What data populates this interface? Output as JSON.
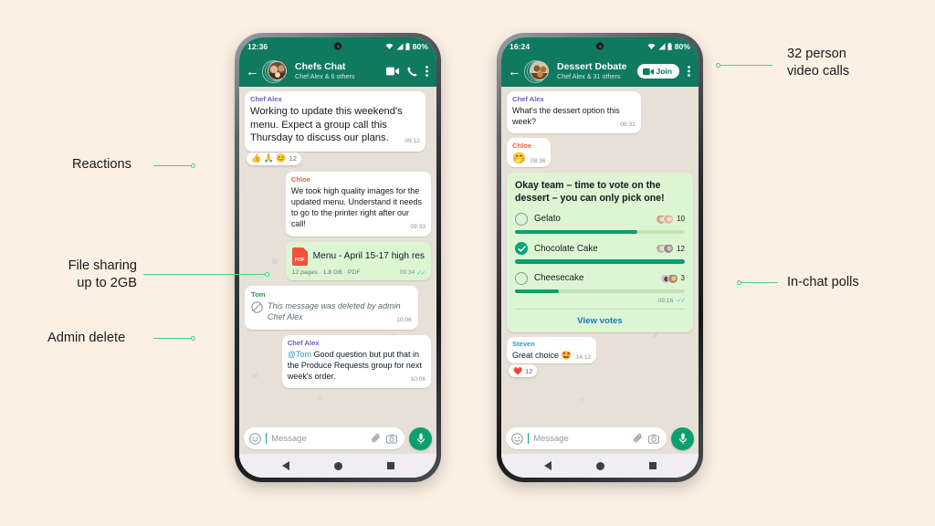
{
  "background_color": "#fcf0e4",
  "brand": {
    "green": "#0f7a60",
    "accent_green": "#0aa06e",
    "link_blue": "#1478c4",
    "lead_green": "#4bd07f"
  },
  "annotations": [
    {
      "id": "video-calls",
      "text": "32 person\nvideo calls"
    },
    {
      "id": "in-chat-polls",
      "text": "In-chat polls"
    },
    {
      "id": "reactions",
      "text": "Reactions"
    },
    {
      "id": "file-sharing",
      "text": "File sharing\nup to 2GB"
    },
    {
      "id": "admin-delete",
      "text": "Admin delete"
    }
  ],
  "phone1": {
    "status": {
      "time": "12:36",
      "battery": "80%"
    },
    "appbar": {
      "title": "Chefs Chat",
      "subtitle": "Chef Alex & 6 others",
      "back_icon": "back-arrow-icon",
      "video_icon": "video-call-icon",
      "call_icon": "phone-call-icon",
      "menu_icon": "overflow-menu-icon"
    },
    "messages": [
      {
        "id": "m1",
        "side": "in",
        "sender": "Chef Alex",
        "sender_color": "purple",
        "text": "Working to update this weekend's menu. Expect a group call this Thursday to discuss our plans.",
        "time": "09:12",
        "reactions": {
          "emojis": "👍 🙏 😊",
          "count": "12"
        }
      },
      {
        "id": "m2",
        "side": "in",
        "sender": "Chloe",
        "sender_color": "orange",
        "text": "We took high quality images for the updated menu. Understand it needs to go to the printer right after our call!",
        "time": "09:33"
      },
      {
        "id": "m3",
        "side": "out",
        "type": "file",
        "file_name": "Menu - April 15-17 high res",
        "file_badge": "PDF",
        "file_meta": "12 pages · 1.8 GB · PDF",
        "time": "09:34",
        "ticks": "read"
      },
      {
        "id": "m4",
        "side": "in",
        "type": "deleted",
        "sender": "Tom",
        "sender_color": "green",
        "text": "This message was deleted by admin Chef Alex",
        "time": "10:06"
      },
      {
        "id": "m5",
        "side": "out",
        "sender": "Chef Alex",
        "sender_color": "purple",
        "mention": "@Tom",
        "text": " Good question but put that in the Produce Requests group for next week's order.",
        "time": "10:06"
      }
    ],
    "composer": {
      "placeholder": "Message",
      "emoji_icon": "emoji-icon",
      "attach_icon": "paperclip-icon",
      "camera_icon": "camera-icon",
      "mic_icon": "microphone-icon"
    }
  },
  "phone2": {
    "status": {
      "time": "16:24",
      "battery": "80%"
    },
    "appbar": {
      "title": "Dessert Debate",
      "subtitle": "Chef Alex & 31 others",
      "join_label": "Join",
      "back_icon": "back-arrow-icon",
      "video_icon": "video-call-icon",
      "menu_icon": "overflow-menu-icon"
    },
    "messages": [
      {
        "id": "p1",
        "side": "in",
        "sender": "Chef Alex",
        "sender_color": "purple",
        "text": "What's the dessert option this week?",
        "time": "08:31"
      },
      {
        "id": "p2",
        "side": "in",
        "sender": "Chloe",
        "sender_color": "orange",
        "emoji": "🤭",
        "time": "08:36"
      }
    ],
    "poll": {
      "question": "Okay team – time to vote on the dessert – you can only pick one!",
      "options": [
        {
          "label": "Gelato",
          "count": "10",
          "percent": 72,
          "selected": false
        },
        {
          "label": "Chocolate Cake",
          "count": "12",
          "percent": 100,
          "selected": true
        },
        {
          "label": "Cheesecake",
          "count": "3",
          "percent": 26,
          "selected": false
        }
      ],
      "time": "09:16",
      "ticks": "read",
      "view_votes_label": "View votes"
    },
    "last_message": {
      "sender": "Steven",
      "sender_color": "blue",
      "text": "Great choice 🤩",
      "time": "14:12",
      "reaction": {
        "emoji": "❤️",
        "count": "12"
      }
    },
    "composer": {
      "placeholder": "Message",
      "emoji_icon": "emoji-icon",
      "attach_icon": "paperclip-icon",
      "camera_icon": "camera-icon",
      "mic_icon": "microphone-icon"
    }
  }
}
